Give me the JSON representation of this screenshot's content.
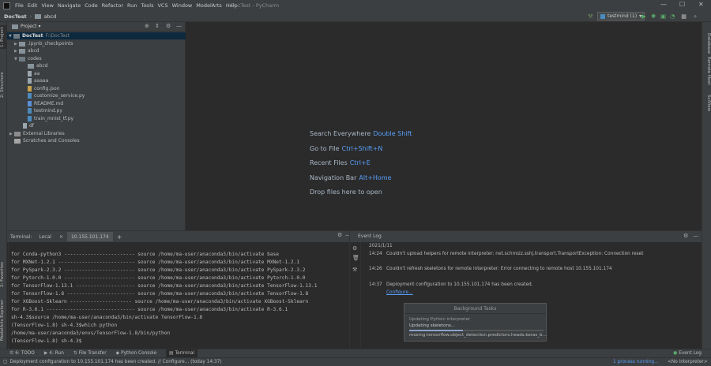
{
  "menubar": {
    "items": [
      "File",
      "Edit",
      "View",
      "Navigate",
      "Code",
      "Refactor",
      "Run",
      "Tools",
      "VCS",
      "Window",
      "ModelArts",
      "Help"
    ],
    "window_title": "DocTest - PyCharm"
  },
  "navbar": {
    "project": "DocTest",
    "folder": "abcd",
    "run_config": "testmind (1)"
  },
  "left_tabs": {
    "project": "1: Project",
    "structure": "2: Structure",
    "favorites": "2: Favorites",
    "modelarts": "ModelArts Explorer"
  },
  "right_tabs": {
    "database": "Database",
    "remote_host": "Remote Host",
    "sciview": "SciView"
  },
  "project_panel": {
    "header": "Project",
    "root_name": "DocTest",
    "root_path": "F:\\DocTest",
    "items": [
      {
        "label": ".ipynb_checkpoints"
      },
      {
        "label": "abcd"
      },
      {
        "label": "codes"
      },
      {
        "label": "abcd"
      },
      {
        "label": "aa"
      },
      {
        "label": "aaaaa"
      },
      {
        "label": "config.json"
      },
      {
        "label": "customize_service.py"
      },
      {
        "label": "README.md"
      },
      {
        "label": "testmind.py"
      },
      {
        "label": "train_mnist_tf.py"
      },
      {
        "label": "df"
      },
      {
        "label": "External Libraries"
      },
      {
        "label": "Scratches and Consoles"
      }
    ]
  },
  "editor": {
    "hints": [
      {
        "label": "Search Everywhere",
        "key": "Double Shift"
      },
      {
        "label": "Go to File",
        "key": "Ctrl+Shift+N"
      },
      {
        "label": "Recent Files",
        "key": "Ctrl+E"
      },
      {
        "label": "Navigation Bar",
        "key": "Alt+Home"
      },
      {
        "label": "Drop files here to open",
        "key": ""
      }
    ]
  },
  "terminal": {
    "title": "Terminal:",
    "tabs": [
      "Local",
      "10.155.101.174"
    ],
    "add": "+",
    "lines": [
      "for Conda-python3 ------------------------ source /home/ma-user/anaconda3/bin/activate base",
      "for MXNet-1.2.1 -------------------------- source /home/ma-user/anaconda3/bin/activate MXNet-1.2.1",
      "for PySpark-2.3.2 ------------------------ source /home/ma-user/anaconda3/bin/activate PySpark-2.3.2",
      "for Pytorch-1.0.0 ------------------------ source /home/ma-user/anaconda3/bin/activate Pytorch-1.0.0",
      "for TensorFlow-1.13.1 -------------------- source /home/ma-user/anaconda3/bin/activate TensorFlow-1.13.1",
      "for TensorFlow-1.8 ----------------------- source /home/ma-user/anaconda3/bin/activate TensorFlow-1.8",
      "for XGBoost-Sklearn --------------------- source /home/ma-user/anaconda3/bin/activate XGBoost-Sklearn",
      "for R-3.6.1 ------------------------------ source /home/ma-user/anaconda3/bin/activate R-3.6.1",
      "sh-4.3$source /home/ma-user/anaconda3/bin/activate TensorFlow-1.8",
      "(TensorFlow-1.8) sh-4.3$which python",
      "/home/ma-user/anaconda3/envs/TensorFlow-1.8/bin/python",
      "(TensorFlow-1.8) sh-4.3$"
    ]
  },
  "event_log": {
    "title": "Event Log",
    "date": "2021/1/11",
    "entries": [
      {
        "time": "14:24",
        "message": "Couldn't upload helpers for remote interpreter: net.schmizz.sshj.transport.TransportException: Connection reset"
      },
      {
        "time": "14:26",
        "message": "Couldn't refresh skeletons for remote interpreter: Error connecting to remote host 10.155.101.174"
      },
      {
        "time": "14:37",
        "message": "Deployment configuration to 10.155.101.174 has been created."
      }
    ],
    "configure_link": "Configure..."
  },
  "background_tasks": {
    "title": "Background Tasks",
    "task1": "Updating Python interpreter",
    "task2": "Updating skeletons...",
    "task3": "moxing.tensorflow.object_detection.predictors.heads.keras_b...",
    "progress": 0.4
  },
  "tool_tabs": {
    "todo": "6: TODO",
    "run": "4: Run",
    "file_transfer": "File Transfer",
    "python_console": "Python Console",
    "terminal": "Terminal",
    "event_log": "Event Log"
  },
  "status": {
    "message": "Deployment configuration to 10.155.101.174 has been created. // Configure... (today 14:37)",
    "process": "1 process running...",
    "interpreter": "<No interpreter>"
  }
}
